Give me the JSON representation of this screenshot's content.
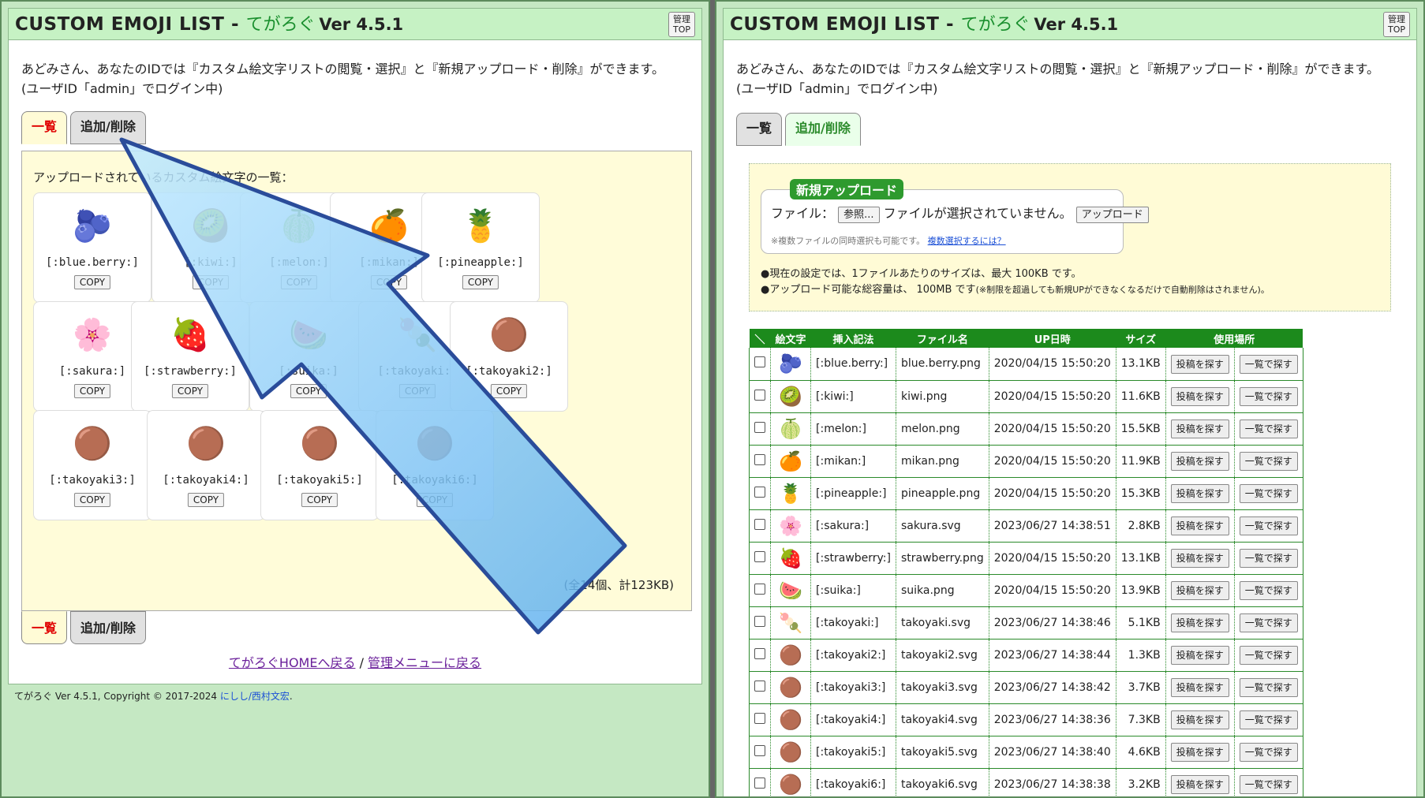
{
  "title": {
    "main": "CUSTOM EMOJI LIST - ",
    "app": "てがろぐ",
    "version": "Ver 4.5.1"
  },
  "admin_button": {
    "line1": "管理",
    "line2": "TOP"
  },
  "message": {
    "line1": "あどみさん、あなたのIDでは『カスタム絵文字リストの閲覧・選択』と『新規アップロード・削除』ができます。",
    "line2": "(ユーザID「admin」でログイン中)"
  },
  "tabs": {
    "list": "一覧",
    "manage": "追加/削除"
  },
  "list_view": {
    "caption": "アップロードされているカスタム絵文字の一覧：",
    "copy_label": "COPY",
    "total": "(全14個、計123KB)",
    "emojis": [
      {
        "code": "[:blue.berry:]",
        "icon": "🫐"
      },
      {
        "code": "[:kiwi:]",
        "icon": "🥝"
      },
      {
        "code": "[:melon:]",
        "icon": "🍈"
      },
      {
        "code": "[:mikan:]",
        "icon": "🍊"
      },
      {
        "code": "[:pineapple:]",
        "icon": "🍍"
      },
      {
        "code": "[:sakura:]",
        "icon": "🌸"
      },
      {
        "code": "[:strawberry:]",
        "icon": "🍓"
      },
      {
        "code": "[:suika:]",
        "icon": "🍉"
      },
      {
        "code": "[:takoyaki:]",
        "icon": "🍡"
      },
      {
        "code": "[:takoyaki2:]",
        "icon": "🟤"
      },
      {
        "code": "[:takoyaki3:]",
        "icon": "🟤"
      },
      {
        "code": "[:takoyaki4:]",
        "icon": "🟤"
      },
      {
        "code": "[:takoyaki5:]",
        "icon": "🟤"
      },
      {
        "code": "[:takoyaki6:]",
        "icon": "🟤"
      }
    ]
  },
  "footer": {
    "home_link": "てがろぐHOMEへ戻る",
    "separator": "/",
    "menu_link": "管理メニューに戻る",
    "copyright_prefix": "てがろぐ Ver 4.5.1, Copyright © 2017-2024 ",
    "author": "にしし/西村文宏",
    "copyright_suffix": "."
  },
  "upload": {
    "legend": "新規アップロード",
    "file_label": "ファイル：",
    "browse": "参照...",
    "no_file": "ファイルが選択されていません。",
    "upload_button": "アップロード",
    "note": "※複数ファイルの同時選択も可能です。",
    "note_link": "複数選択するには？",
    "rule1": "●現在の設定では、1ファイルあたりのサイズは、最大 100KB です。",
    "rule2": "●アップロード可能な総容量は、 100MB です",
    "rule2_note": "(※制限を超過しても新規UPができなくなるだけで自動削除はされません)。"
  },
  "table": {
    "headers": [
      "＼",
      "絵文字",
      "挿入記法",
      "ファイル名",
      "UP日時",
      "サイズ",
      "使用場所"
    ],
    "btn_post": "投稿を探す",
    "btn_list": "一覧で探す",
    "rows": [
      {
        "code": "[:blue.berry:]",
        "file": "blue.berry.png",
        "date": "2020/04/15 15:50:20",
        "size": "13.1KB"
      },
      {
        "code": "[:kiwi:]",
        "file": "kiwi.png",
        "date": "2020/04/15 15:50:20",
        "size": "11.6KB"
      },
      {
        "code": "[:melon:]",
        "file": "melon.png",
        "date": "2020/04/15 15:50:20",
        "size": "15.5KB"
      },
      {
        "code": "[:mikan:]",
        "file": "mikan.png",
        "date": "2020/04/15 15:50:20",
        "size": "11.9KB"
      },
      {
        "code": "[:pineapple:]",
        "file": "pineapple.png",
        "date": "2020/04/15 15:50:20",
        "size": "15.3KB"
      },
      {
        "code": "[:sakura:]",
        "file": "sakura.svg",
        "date": "2023/06/27 14:38:51",
        "size": "2.8KB"
      },
      {
        "code": "[:strawberry:]",
        "file": "strawberry.png",
        "date": "2020/04/15 15:50:20",
        "size": "13.1KB"
      },
      {
        "code": "[:suika:]",
        "file": "suika.png",
        "date": "2020/04/15 15:50:20",
        "size": "13.9KB"
      },
      {
        "code": "[:takoyaki:]",
        "file": "takoyaki.svg",
        "date": "2023/06/27 14:38:46",
        "size": "5.1KB"
      },
      {
        "code": "[:takoyaki2:]",
        "file": "takoyaki2.svg",
        "date": "2023/06/27 14:38:44",
        "size": "1.3KB"
      },
      {
        "code": "[:takoyaki3:]",
        "file": "takoyaki3.svg",
        "date": "2023/06/27 14:38:42",
        "size": "3.7KB"
      },
      {
        "code": "[:takoyaki4:]",
        "file": "takoyaki4.svg",
        "date": "2023/06/27 14:38:36",
        "size": "7.3KB"
      },
      {
        "code": "[:takoyaki5:]",
        "file": "takoyaki5.svg",
        "date": "2023/06/27 14:38:40",
        "size": "4.6KB"
      },
      {
        "code": "[:takoyaki6:]",
        "file": "takoyaki6.svg",
        "date": "2023/06/27 14:38:38",
        "size": "3.2KB"
      }
    ]
  }
}
